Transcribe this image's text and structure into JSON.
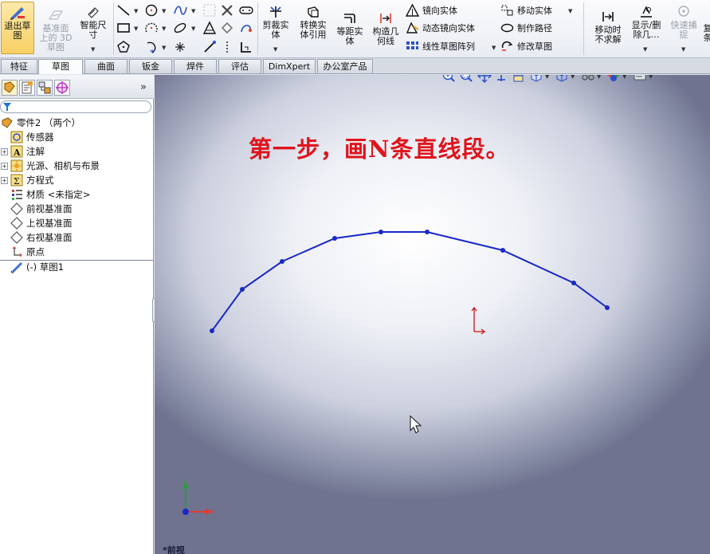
{
  "ribbon": {
    "exit_sketch": "退出草\n图",
    "ref_plane": "基准面\n上的 3D\n草图",
    "smart_dim": "智能尺\n寸",
    "trim": "剪裁实\n体",
    "convert": "转换实\n体引用",
    "offset": "等距实\n体",
    "construction": "构造几\n何线",
    "mirror": "镜向实体",
    "dyn_mirror": "动态镜向实体",
    "linear_pattern": "线性草图阵列",
    "move": "移动实体",
    "make_path": "制作路径",
    "modify_sketch": "修改草图",
    "move_unsolved": "移动时\n不求解",
    "show_delete": "显示/删\n除几…",
    "quick_snap": "快速捕\n捉",
    "cut_off": "复\n条"
  },
  "tabs": [
    "特征",
    "草图",
    "曲面",
    "钣金",
    "焊件",
    "评估",
    "DimXpert",
    "办公室产品"
  ],
  "active_tab": "草图",
  "tree": {
    "root": "零件2  （两个）",
    "items": [
      {
        "label": "传感器",
        "expand": false
      },
      {
        "label": "注解",
        "expand": true
      },
      {
        "label": "光源、相机与布景",
        "expand": true
      },
      {
        "label": "方程式",
        "expand": true
      },
      {
        "label": "材质 <未指定>",
        "expand": false
      },
      {
        "label": "前视基准面",
        "expand": false
      },
      {
        "label": "上视基准面",
        "expand": false
      },
      {
        "label": "右视基准面",
        "expand": false
      },
      {
        "label": "原点",
        "expand": false
      }
    ],
    "sketch": "(-) 草图1"
  },
  "viewport": {
    "instruction": "第一步，画N条直线段。",
    "view_label": "*前视",
    "axis_y": "Y",
    "axis_x": "X",
    "polyline_color": "#1a28c8"
  }
}
